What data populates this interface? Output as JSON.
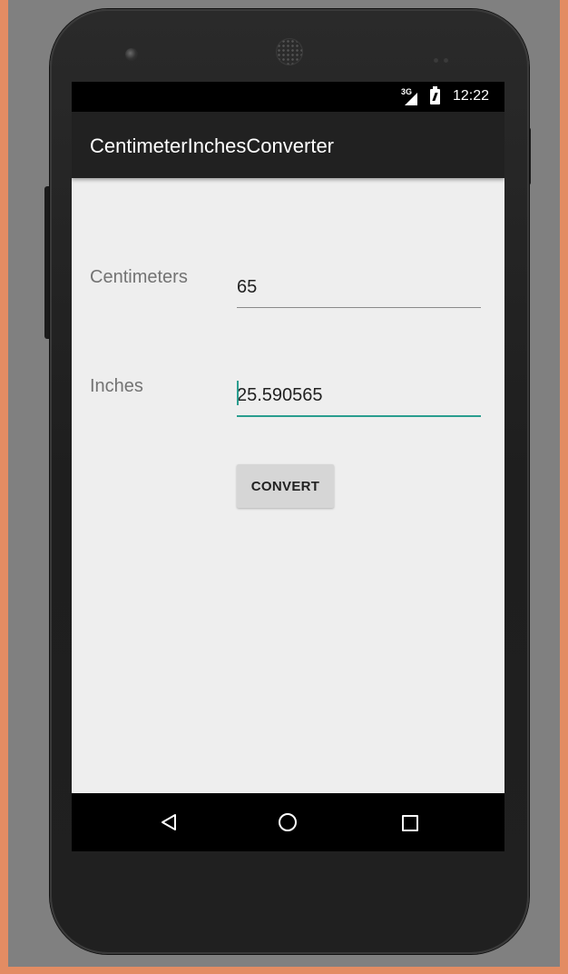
{
  "status_bar": {
    "network_label": "3G",
    "time": "12:22"
  },
  "app": {
    "title": "CentimeterInchesConverter"
  },
  "form": {
    "centimeters_label": "Centimeters",
    "centimeters_value": "65",
    "inches_label": "Inches",
    "inches_value": "25.590565",
    "convert_label": "CONVERT"
  },
  "nav_bar": {
    "back_icon": "back-triangle-icon",
    "home_icon": "home-circle-icon",
    "recents_icon": "recents-square-icon"
  },
  "colors": {
    "accent": "#2a9d8f",
    "app_bar": "#212121",
    "background": "#eeeeee"
  }
}
